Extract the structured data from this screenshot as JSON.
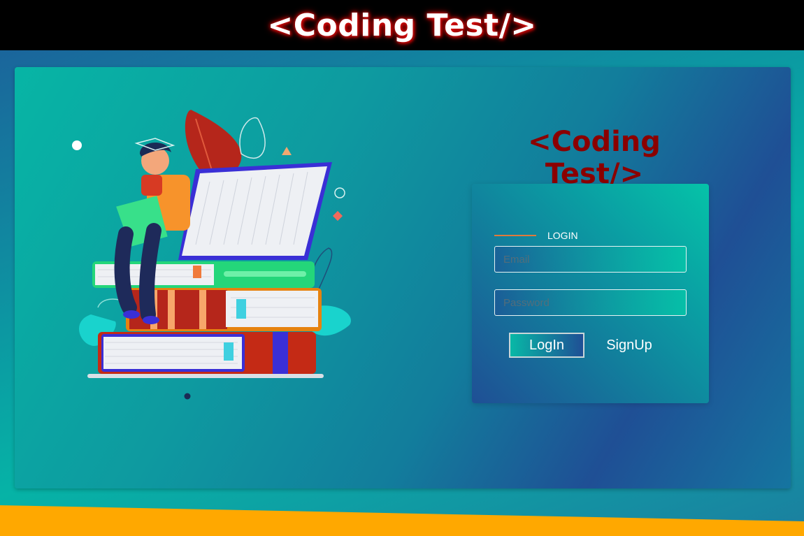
{
  "header": {
    "title": "<Coding Test/>"
  },
  "brand": {
    "title": "<Coding Test/>"
  },
  "login": {
    "section_label": "LOGIN",
    "email_placeholder": "Email",
    "password_placeholder": "Password",
    "login_label": "LogIn",
    "signup_label": "SignUp"
  },
  "colors": {
    "brand_title": "#8b0000",
    "accent_line": "#e07a3b",
    "footer": "#ffa800"
  },
  "illustration": {
    "icon": "student-on-books-illustration"
  }
}
